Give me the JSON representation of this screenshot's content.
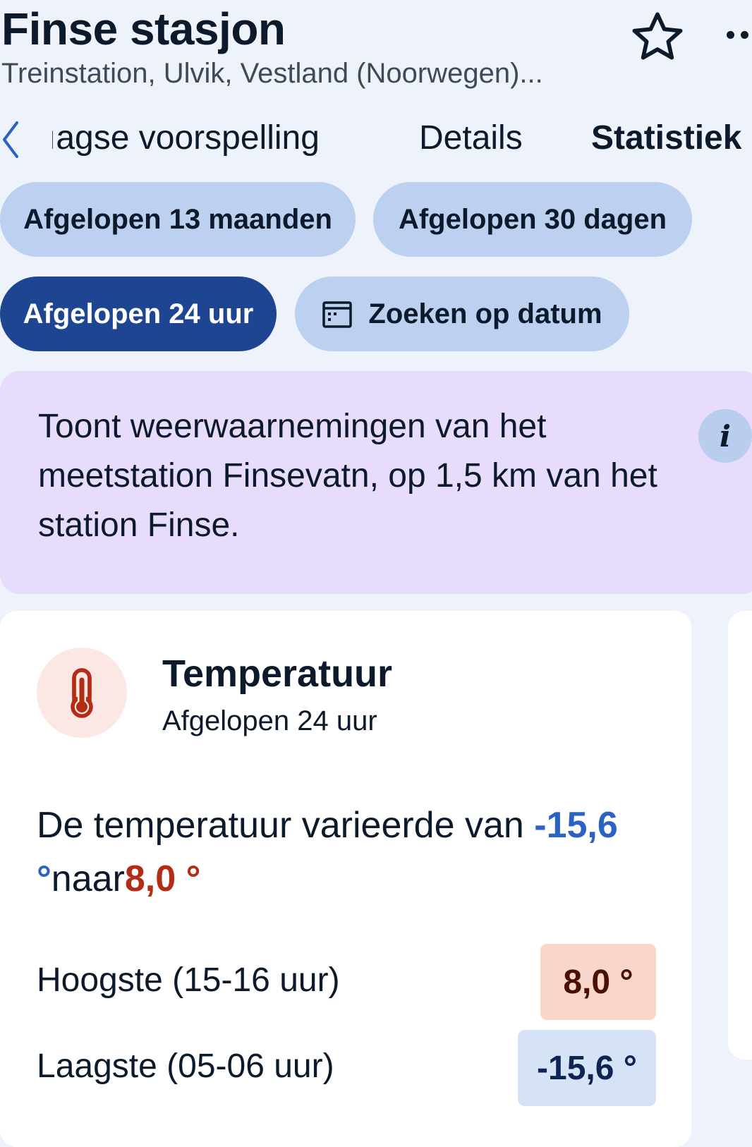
{
  "header": {
    "title": "Finse stasjon",
    "subtitle": "Treinstation, Ulvik, Vestland (Noorwegen)...",
    "favorite_icon": "star-outline-icon",
    "more_icon": "more-dots-icon"
  },
  "tabs": {
    "back_icon": "chevron-left-icon",
    "items": [
      {
        "label": "ıagse voorspelling",
        "active": false
      },
      {
        "label": "Details",
        "active": false
      },
      {
        "label": "Statistiek",
        "active": true
      }
    ]
  },
  "filters": {
    "items": [
      {
        "label": "Afgelopen 13 maanden",
        "selected": false
      },
      {
        "label": "Afgelopen 30 dagen",
        "selected": false
      },
      {
        "label": "Afgelopen 24 uur",
        "selected": true
      },
      {
        "label": "Zoeken op datum",
        "selected": false,
        "icon": "calendar-icon"
      }
    ]
  },
  "info_banner": {
    "text": "Toont weerwaarnemingen van het meetstation Finsevatn, op 1,5 km van het station Finse.",
    "icon": "info-icon",
    "icon_text": "i"
  },
  "temperature_card": {
    "icon": "thermometer-icon",
    "title": "Temperatuur",
    "subtitle": "Afgelopen 24 uur",
    "summary_prefix": "De temperatuur varieerde van ",
    "summary_low": "-15,6 °",
    "summary_mid": "naar",
    "summary_high": "8,0 °",
    "highest_label": "Hoogste (15-16 uur)",
    "highest_value": "8,0 °",
    "lowest_label": "Laagste (05-06 uur)",
    "lowest_value": "-15,6 °"
  },
  "colors": {
    "background": "#eef3fb",
    "chip": "#bcd0ef",
    "chip_selected": "#1d4591",
    "banner": "#e7dcfb",
    "cold": "#2a63c4",
    "warm": "#b22d14",
    "high_badge": "#f8d6cb",
    "low_badge": "#d6e3f7"
  }
}
